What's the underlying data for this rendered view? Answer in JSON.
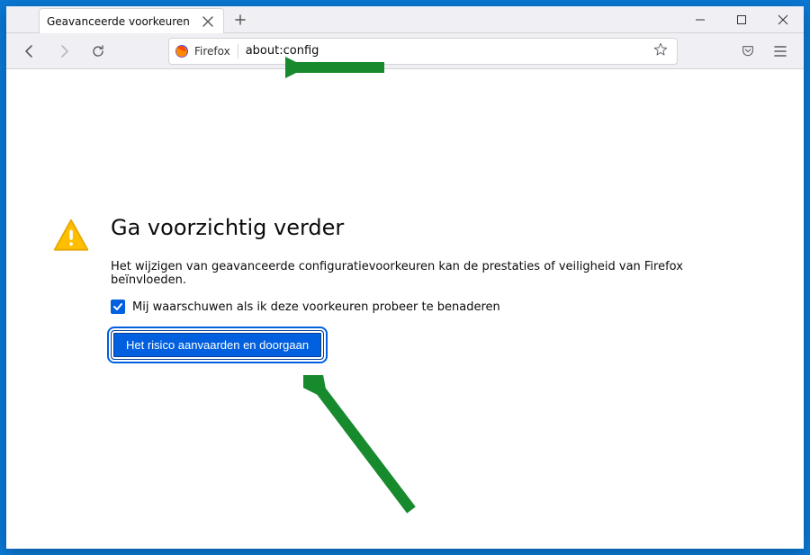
{
  "window": {
    "tab_title": "Geavanceerde voorkeuren"
  },
  "urlbar": {
    "identity_label": "Firefox",
    "url": "about:config"
  },
  "config_page": {
    "heading": "Ga voorzichtig verder",
    "description": "Het wijzigen van geavanceerde configuratievoorkeuren kan de prestaties of veiligheid van Firefox beïnvloeden.",
    "checkbox_label": "Mij waarschuwen als ik deze voorkeuren probeer te benaderen",
    "checkbox_checked": true,
    "accept_label": "Het risico aanvaarden en doorgaan"
  }
}
